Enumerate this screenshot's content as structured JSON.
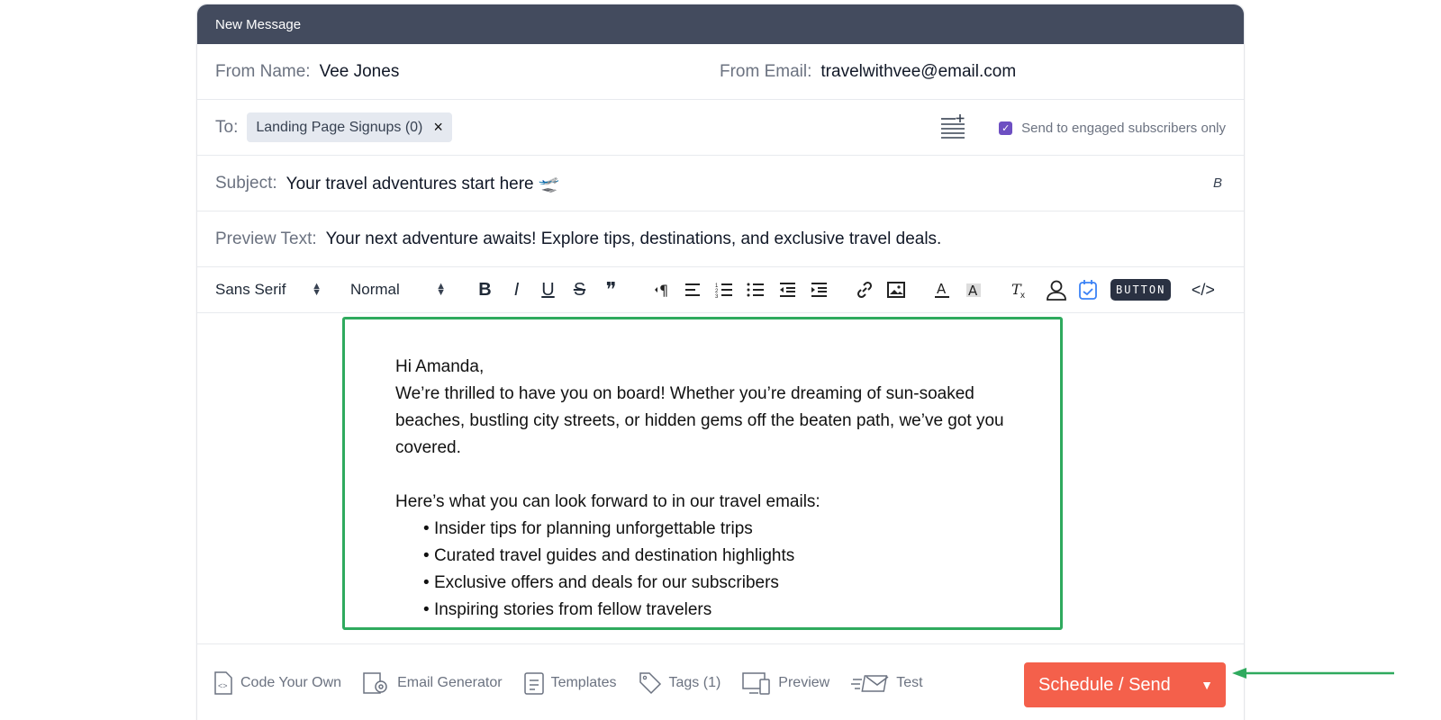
{
  "window": {
    "title": "New Message"
  },
  "from": {
    "name_label": "From Name:",
    "name_value": "Vee Jones",
    "email_label": "From Email:",
    "email_value": "travelwithvee@email.com"
  },
  "to": {
    "label": "To:",
    "chip": "Landing Page Signups (0)",
    "chip_remove": "×",
    "engaged_checked": true,
    "engaged_label": "Send to engaged subscribers only"
  },
  "subject": {
    "label": "Subject:",
    "value": "Your travel adventures start here 🛫",
    "bold_marker": "B"
  },
  "preview": {
    "label": "Preview Text:",
    "value": "Your next adventure awaits! Explore tips, destinations, and exclusive travel deals."
  },
  "toolbar": {
    "font": "Sans Serif",
    "size": "Normal",
    "bold": "B",
    "italic": "I",
    "underline": "U",
    "strike": "S",
    "quote": "❞",
    "button_label": "BUTTON",
    "code": "</>"
  },
  "body": {
    "greeting": "Hi Amanda,",
    "intro": "We’re thrilled to have you on board! Whether you’re dreaming of sun-soaked beaches, bustling city streets, or hidden gems off the beaten path, we’ve got you covered.",
    "lead": "Here’s what you can look forward to in our travel emails:",
    "bullets": [
      "Insider tips for planning unforgettable trips",
      "Curated travel guides and destination highlights",
      "Exclusive offers and deals for our subscribers",
      "Inspiring stories from fellow travelers"
    ]
  },
  "bottom": {
    "code_your_own": "Code Your Own",
    "email_generator": "Email Generator",
    "templates": "Templates",
    "tags": "Tags (1)",
    "preview": "Preview",
    "test": "Test",
    "send": "Schedule / Send"
  },
  "colors": {
    "header": "#434b5e",
    "send": "#f4604b",
    "highlight": "#2faa5e",
    "checkbox": "#6d4fc2"
  }
}
